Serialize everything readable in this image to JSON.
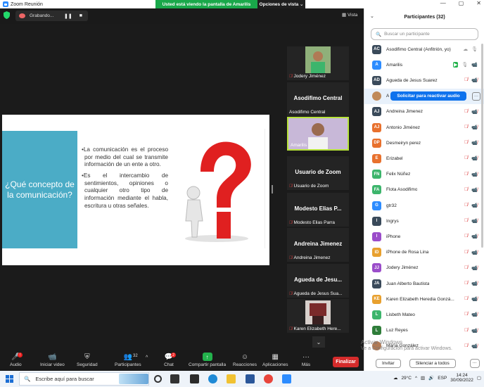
{
  "window": {
    "title": "Zoom Reunión",
    "controls": [
      "—",
      "▢",
      "✕"
    ]
  },
  "share_banner": "Usted está viendo la pantalla de Amarilis",
  "view_options": "Opciones de vista ⌄",
  "recording": {
    "label": "Grabando...",
    "pause": "❚❚",
    "stop": "■"
  },
  "view_label": "Vista",
  "slide": {
    "title": "¿Qué concepto de la comunicación?",
    "bullets": [
      "La comunicación es el proceso por medio del cual se transmite información de un ente a otro.",
      "Es el intercambio de sentimientos, opiniones o cualquier otro tipo de información mediante el habla, escritura u otras señales."
    ]
  },
  "gallery": [
    {
      "name": "Jodery Jiménez",
      "big": "",
      "muted": true,
      "video": true
    },
    {
      "name": "Asodifimo Central",
      "big": "Asodifimo Central",
      "muted": false,
      "video": false
    },
    {
      "name": "Amarilis",
      "big": "",
      "muted": false,
      "video": true
    },
    {
      "name": "Usuario de Zoom",
      "big": "Usuario de Zoom",
      "muted": true,
      "video": false
    },
    {
      "name": "Modesto Elias Parra",
      "big": "Modesto Elias P...",
      "muted": true,
      "video": false
    },
    {
      "name": "Andreina Jimenez",
      "big": "Andreina Jimenez",
      "muted": true,
      "video": false
    },
    {
      "name": "Agueda de Jesus Sua...",
      "big": "Agueda de Jesu...",
      "muted": true,
      "video": false
    },
    {
      "name": "Karen Elizabeth Here...",
      "big": "",
      "muted": true,
      "video": true
    }
  ],
  "gallery_more": "⌄",
  "toolbar": {
    "audio": "Audio",
    "video": "Iniciar video",
    "security": "Seguridad",
    "participants": "Participantes",
    "participants_count": "32",
    "chat": "Chat",
    "chat_badge": "2",
    "share": "Compartir pantalla",
    "reactions": "Reacciones",
    "apps": "Aplicaciones",
    "more": "Más",
    "end": "Finalizar"
  },
  "panel": {
    "title": "Participantes (32)",
    "search_placeholder": "Buscar un participante",
    "reactivate": "Solicitar para reactivar audio",
    "invite": "Invitar",
    "mute_all": "Silenciar a todos",
    "more": "···",
    "participants": [
      {
        "initials": "AC",
        "name": "Asodifimo Central (Anfitrión, yo)",
        "color": "#3a4a5a",
        "state": "host"
      },
      {
        "initials": "A",
        "name": "Amarilis",
        "color": "#2d8cff",
        "state": "sharing"
      },
      {
        "initials": "AD",
        "name": "Agueda de Jesus Suarez",
        "color": "#3a4a5a",
        "state": "muted"
      },
      {
        "initials": "",
        "name": "A",
        "color": "#c08a5a",
        "state": "highlight"
      },
      {
        "initials": "AJ",
        "name": "Andreina Jimenez",
        "color": "#3a4a5a",
        "state": "muted"
      },
      {
        "initials": "AJ",
        "name": "Antonio Jiménez",
        "color": "#e8712e",
        "state": "muted"
      },
      {
        "initials": "DP",
        "name": "Desmeiryn perez",
        "color": "#e8712e",
        "state": "muted"
      },
      {
        "initials": "E",
        "name": "Erizabel",
        "color": "#e8712e",
        "state": "muted"
      },
      {
        "initials": "FN",
        "name": "Felix Núñez",
        "color": "#3db56c",
        "state": "muted"
      },
      {
        "initials": "FA",
        "name": "Flota Asodifimo",
        "color": "#3db56c",
        "state": "muted"
      },
      {
        "initials": "G",
        "name": "gtr32",
        "color": "#2d8cff",
        "state": "muted"
      },
      {
        "initials": "I",
        "name": "Ingrys",
        "color": "#3a4a5a",
        "state": "muted"
      },
      {
        "initials": "I",
        "name": "iPhone",
        "color": "#9b4dca",
        "state": "muted"
      },
      {
        "initials": "ID",
        "name": "iPhone de Rosa Lina",
        "color": "#e8a02e",
        "state": "muted"
      },
      {
        "initials": "JJ",
        "name": "Jodery Jiménez",
        "color": "#9b4dca",
        "state": "muted"
      },
      {
        "initials": "JA",
        "name": "Juan Alberto Bautista",
        "color": "#3a4a5a",
        "state": "muted"
      },
      {
        "initials": "KE",
        "name": "Karen Elizabeth Heredia Gonzá...",
        "color": "#e8a02e",
        "state": "muted"
      },
      {
        "initials": "L",
        "name": "Lisbeth Mateo",
        "color": "#3db56c",
        "state": "muted"
      },
      {
        "initials": "L",
        "name": "Luz Reyes",
        "color": "#2f7d3a",
        "state": "muted"
      },
      {
        "initials": "",
        "name": "María González",
        "color": "#b07a55",
        "state": "muted"
      }
    ]
  },
  "watermark": {
    "line1": "Activar Windows",
    "line2": "Ve a Configuración para activar Windows."
  },
  "taskbar": {
    "search_placeholder": "Escribe aquí para buscar",
    "temperature": "29°C",
    "language": "ESP",
    "time": "14:24",
    "date": "30/09/2022"
  }
}
